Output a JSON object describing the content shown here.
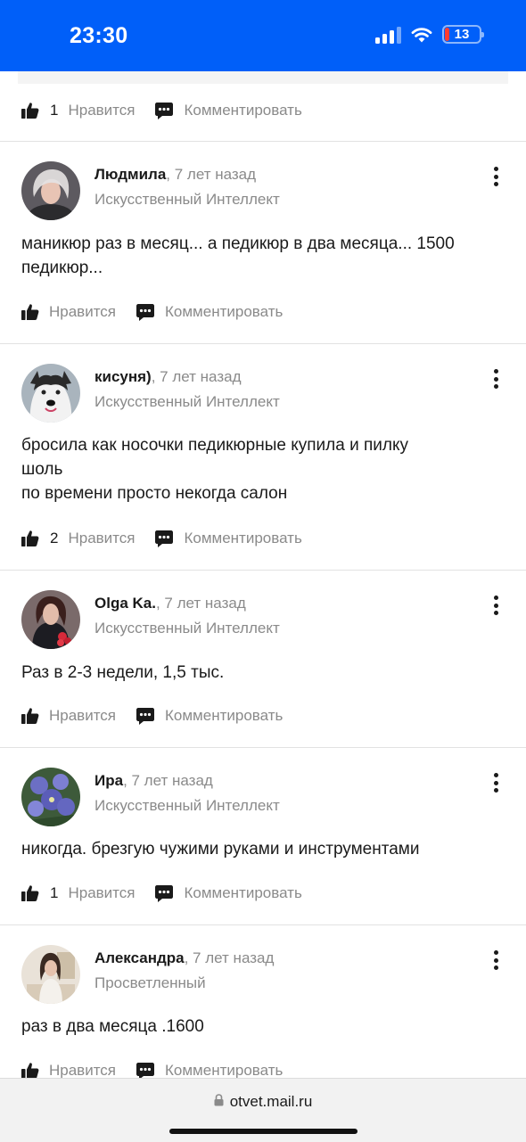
{
  "status_bar": {
    "time": "23:30",
    "battery": "13",
    "color": "#005ff9"
  },
  "top_partial": {
    "like_count": "1",
    "like_label": "Нравится",
    "comment_label": "Комментировать"
  },
  "answers": [
    {
      "author": "Людмила",
      "time": ", 7 лет назад",
      "rank": "Искусственный Интеллект",
      "text": "маникюр раз в месяц... а педикюр в два месяца... 1500\nпедикюр...",
      "like_count": "",
      "like_label": "Нравится",
      "comment_label": "Комментировать"
    },
    {
      "author": "кисуня)",
      "time": ", 7 лет назад",
      "rank": "Искусственный Интеллект",
      "text": "бросила как носочки педикюрные купила и пилку\nшоль\nпо времени просто некогда салон",
      "like_count": "2",
      "like_label": "Нравится",
      "comment_label": "Комментировать"
    },
    {
      "author": "Olga Ka.",
      "time": ", 7 лет назад",
      "rank": "Искусственный Интеллект",
      "text": "Раз в 2-3 недели, 1,5 тыс.",
      "like_count": "",
      "like_label": "Нравится",
      "comment_label": "Комментировать"
    },
    {
      "author": "Ира",
      "time": ", 7 лет назад",
      "rank": "Искусственный Интеллект",
      "text": "никогда. брезгую чужими руками и инструментами",
      "like_count": "1",
      "like_label": "Нравится",
      "comment_label": "Комментировать"
    },
    {
      "author": "Александра",
      "time": ", 7 лет назад",
      "rank": "Просветленный",
      "text": "раз в два месяца .1600",
      "like_count": "",
      "like_label": "Нравится",
      "comment_label": "Комментировать"
    }
  ],
  "browser": {
    "url": "otvet.mail.ru"
  },
  "icons": {
    "like": "thumbs-up-icon",
    "comment": "comment-bubble-icon",
    "menu": "more-vertical-icon",
    "lock": "lock-icon"
  }
}
